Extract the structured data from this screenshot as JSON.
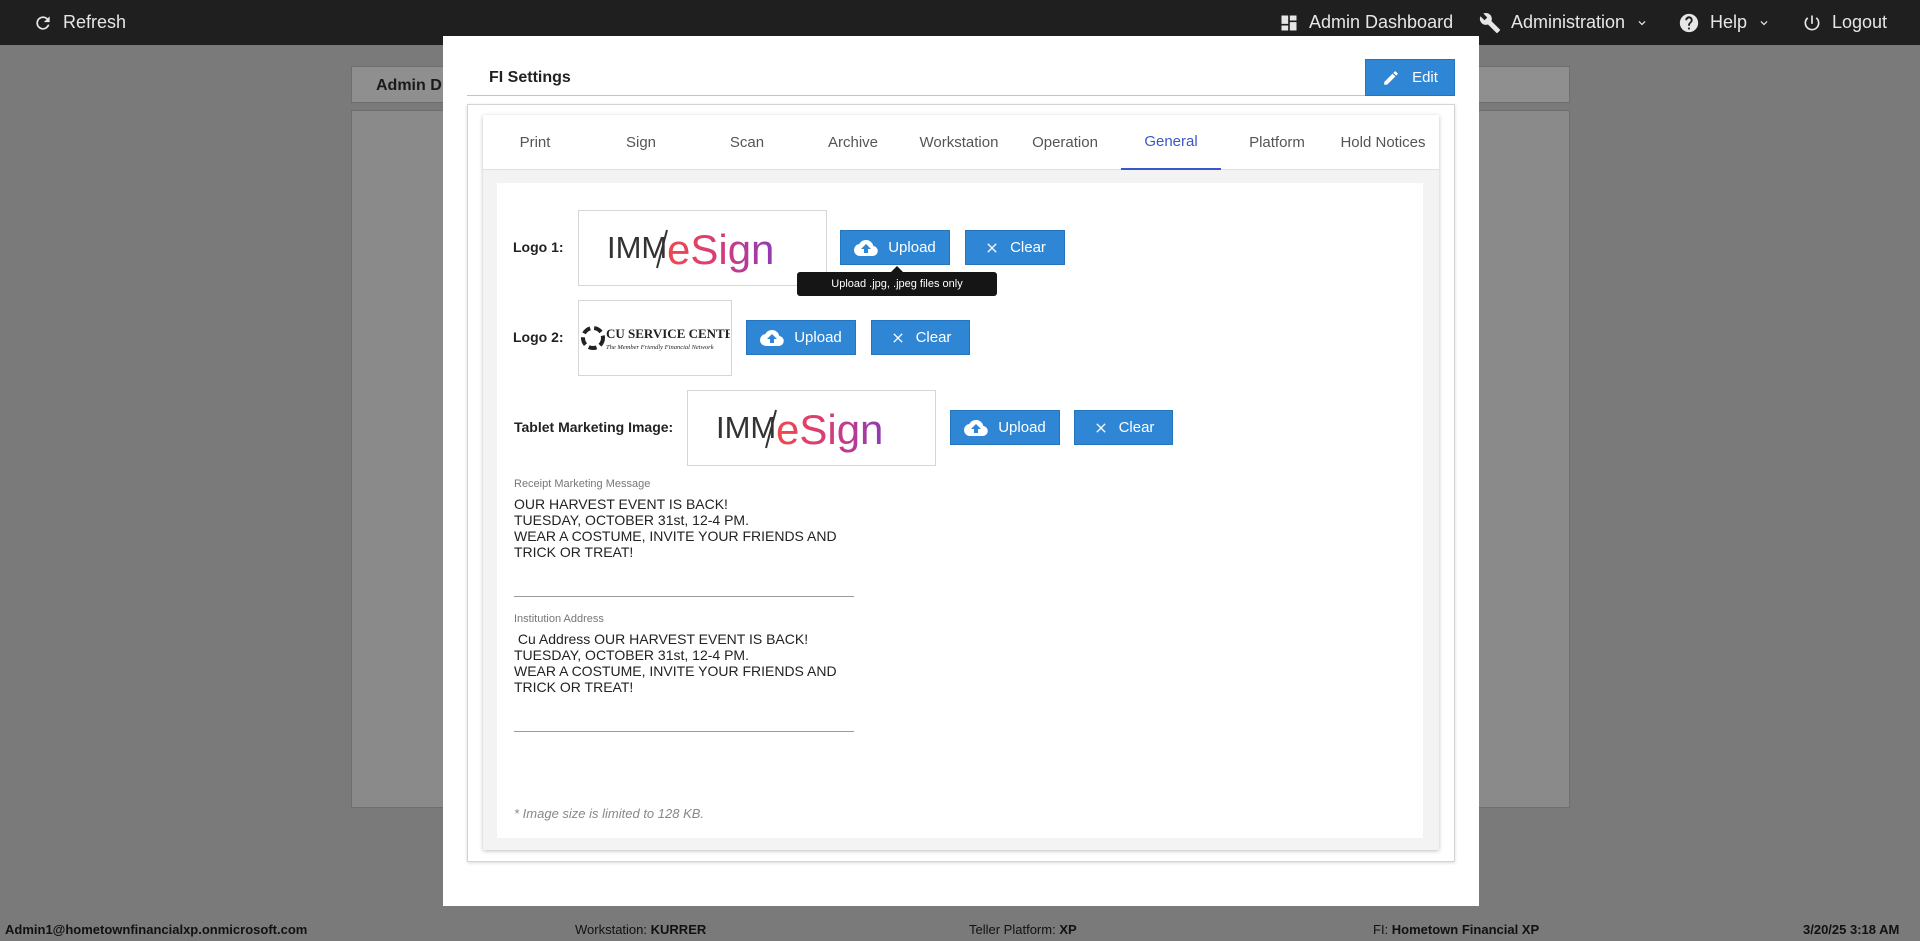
{
  "topbar": {
    "refresh": "Refresh",
    "admin_dashboard": "Admin Dashboard",
    "administration": "Administration",
    "help": "Help",
    "logout": "Logout"
  },
  "background": {
    "header_title": "Admin D"
  },
  "modal": {
    "title": "FI Settings",
    "edit_label": "Edit",
    "tabs": [
      "Print",
      "Sign",
      "Scan",
      "Archive",
      "Workstation",
      "Operation",
      "General",
      "Platform",
      "Hold Notices"
    ],
    "active_tab": "General",
    "logo1": {
      "label": "Logo 1:",
      "upload": "Upload",
      "clear": "Clear",
      "image_text_a": "IMM",
      "image_text_b": "eSign"
    },
    "tooltip": "Upload .jpg, .jpeg files only",
    "logo2": {
      "label": "Logo 2:",
      "upload": "Upload",
      "clear": "Clear",
      "image_text_a": "CU SERVICE CENTERS",
      "image_text_b": "The Member Friendly Financial Network"
    },
    "tablet": {
      "label": "Tablet Marketing Image:",
      "upload": "Upload",
      "clear": "Clear",
      "image_text_a": "IMM",
      "image_text_b": "eSign"
    },
    "receipt": {
      "label": "Receipt Marketing Message",
      "value": "OUR HARVEST EVENT IS BACK!\nTUESDAY, OCTOBER 31st, 12-4 PM.\nWEAR A COSTUME, INVITE YOUR FRIENDS AND\nTRICK OR TREAT!"
    },
    "address": {
      "label": "Institution Address",
      "value": " Cu Address OUR HARVEST EVENT IS BACK!\nTUESDAY, OCTOBER 31st, 12-4 PM.\nWEAR A COSTUME, INVITE YOUR FRIENDS AND\nTRICK OR TREAT!"
    },
    "note": "* Image size is limited to 128 KB."
  },
  "status": {
    "user": "Admin1@hometownfinancialxp.onmicrosoft.com",
    "workstation_label": "Workstation:",
    "workstation_value": "KURRER",
    "platform_label": "Teller Platform:",
    "platform_value": "XP",
    "fi_label": "FI:",
    "fi_value": "Hometown Financial XP",
    "datetime": "3/20/25 3:18 AM"
  },
  "colors": {
    "accent": "#2f86d5",
    "tab_active": "#3b57c9",
    "topbar": "#1f1f1f"
  }
}
